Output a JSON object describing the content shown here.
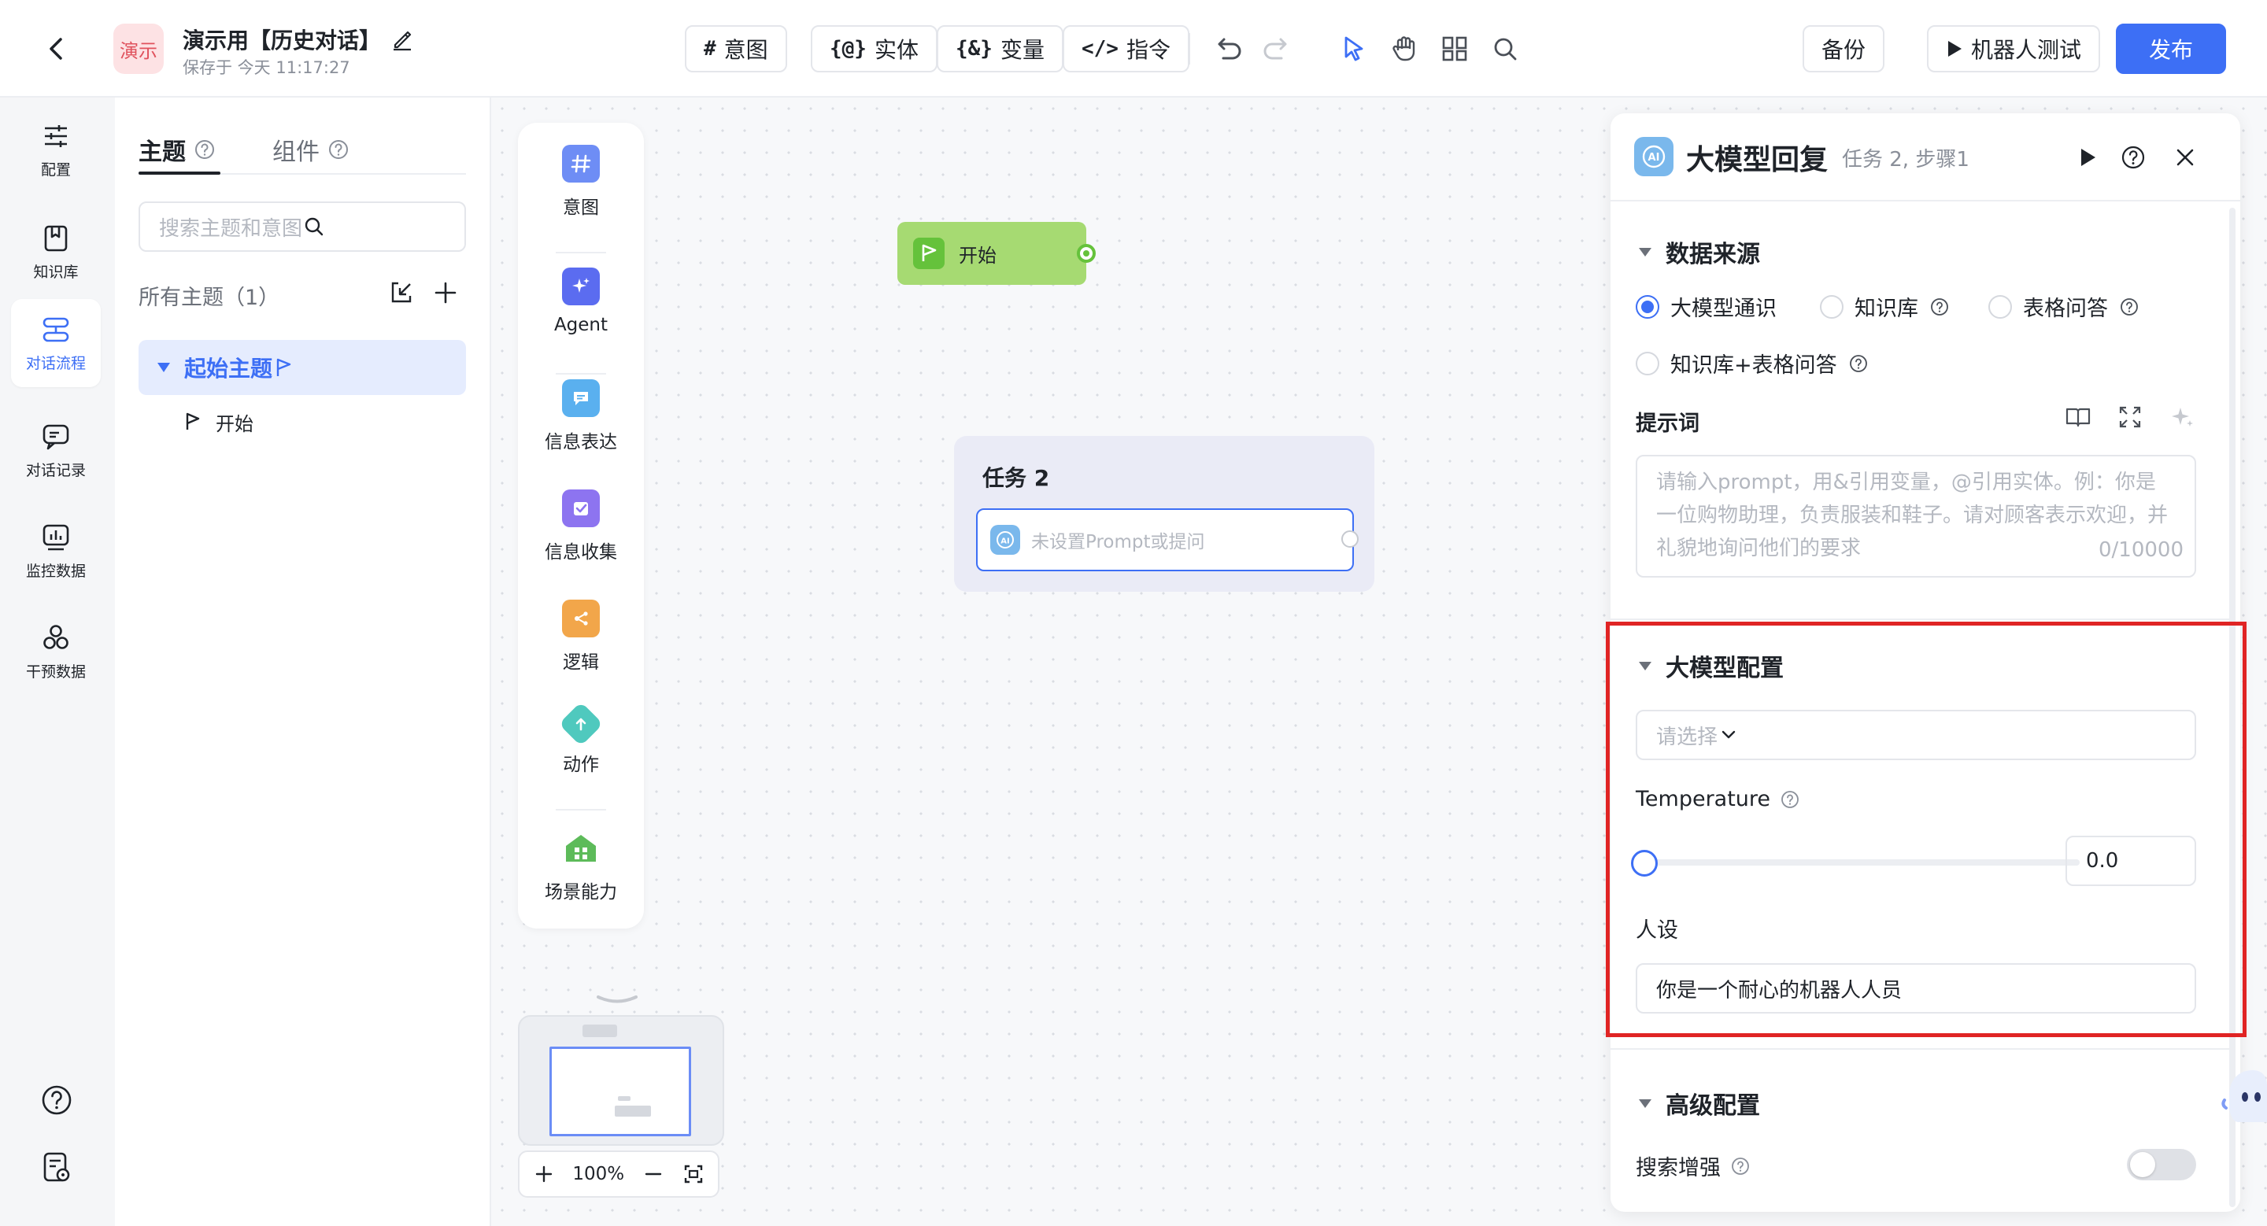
{
  "header": {
    "app_badge": "演示",
    "app_title": "演示用【历史对话】",
    "saved_text": "保存于 今天 11:17:27",
    "toolbar": [
      {
        "glyph": "#",
        "label": "意图"
      },
      {
        "glyph": "{@}",
        "label": "实体"
      },
      {
        "glyph": "{&}",
        "label": "变量"
      },
      {
        "glyph": "</>",
        "label": "指令"
      }
    ],
    "backup_label": "备份",
    "test_label": "机器人测试",
    "publish_label": "发布"
  },
  "leftnav": {
    "items": [
      {
        "label": "配置",
        "icon": "sliders-icon"
      },
      {
        "label": "知识库",
        "icon": "bookmark-icon"
      },
      {
        "label": "对话流程",
        "icon": "flow-icon",
        "active": true
      },
      {
        "label": "对话记录",
        "icon": "chat-icon"
      },
      {
        "label": "监控数据",
        "icon": "chart-icon"
      },
      {
        "label": "干预数据",
        "icon": "circles-icon"
      }
    ]
  },
  "topics": {
    "tab_topic": "主题",
    "tab_component": "组件",
    "search_placeholder": "搜索主题和意图",
    "all_topics": "所有主题（1）",
    "topic_name": "起始主题",
    "start_item": "开始"
  },
  "palette": {
    "items": [
      {
        "label": "意图",
        "icon": "hash-icon",
        "color": "#6e8df5"
      },
      {
        "label": "Agent",
        "icon": "sparkle-icon",
        "color": "#5b6cf0"
      },
      {
        "label": "信息表达",
        "icon": "message-icon",
        "color": "#5ab0ef"
      },
      {
        "label": "信息收集",
        "icon": "collect-icon",
        "color": "#8d74f0"
      },
      {
        "label": "逻辑",
        "icon": "logic-icon",
        "color": "#f2a64a"
      },
      {
        "label": "动作",
        "icon": "action-icon",
        "color": "#4fc9be"
      },
      {
        "label": "场景能力",
        "icon": "scene-icon",
        "color": "#5dbb5a"
      }
    ]
  },
  "canvas": {
    "start_node": "开始",
    "task_title": "任务 2",
    "task_step": "未设置Prompt或提问",
    "zoom": "100%"
  },
  "config": {
    "title": "大模型回复",
    "subtitle": "任务 2, 步骤1",
    "data_source": {
      "title": "数据来源",
      "options": [
        "大模型通识",
        "知识库",
        "表格问答",
        "知识库+表格问答"
      ],
      "selected": "大模型通识"
    },
    "prompt": {
      "label": "提示词",
      "placeholder": "请输入prompt，用&引用变量，@引用实体。例：你是一位购物助理，负责服装和鞋子。请对顾客表示欢迎，并礼貌地询问他们的要求",
      "count": "0/10000"
    },
    "model_config": {
      "title": "大模型配置",
      "select_placeholder": "请选择",
      "temperature_label": "Temperature",
      "temperature_value": "0.0",
      "persona_label": "人设",
      "persona_value": "你是一个耐心的机器人人员"
    },
    "advanced": {
      "title": "高级配置",
      "search_enhance": "搜索增强",
      "search_enhance_on": false
    }
  },
  "colors": {
    "primary": "#3d6ff5",
    "highlight": "#e02424",
    "start_node": "#a6da72"
  }
}
